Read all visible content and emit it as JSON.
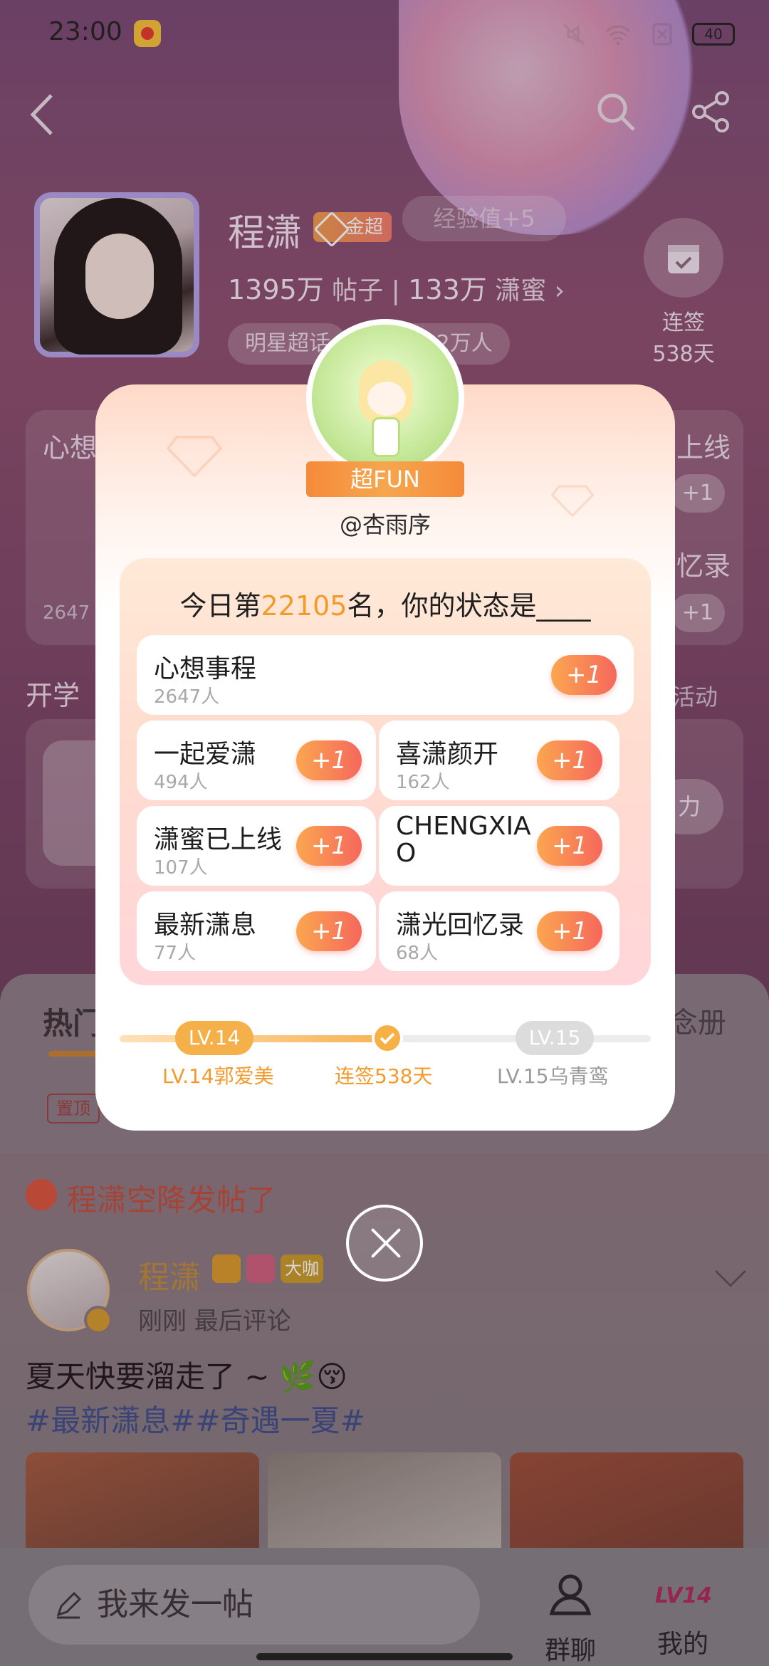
{
  "status_bar": {
    "time": "23:00",
    "battery": "40"
  },
  "header": {
    "name": "程潇",
    "badge": "金超",
    "ghost_pill": "经验值+5",
    "posts_count": "1395万",
    "posts_label": "帖子",
    "fans_count": "133万",
    "fans_label": "潇蜜",
    "tags": [
      "明星超话",
      "签到2.2万人"
    ],
    "checkin_label": "连签",
    "checkin_days": "538天"
  },
  "background": {
    "card_left_title": "心想",
    "card_left_count": "2647",
    "card_right_1": "上线",
    "card_right_2": "忆录",
    "plus": "+1",
    "section_left": "开学",
    "section_right": "活动",
    "tab_hot": "热门",
    "tab_right": "念册",
    "pin_label": "置顶",
    "post_title": "程潇空降发帖了",
    "post_name": "程潇",
    "post_level_badge": "大咖",
    "post_meta": "刚刚 最后评论",
    "post_text": "夏天快要溜走了 ~ 🌿😚",
    "post_tags": "#最新潇息##奇遇一夏#",
    "compose_placeholder": "我来发一帖",
    "nav_group": "群聊",
    "nav_mine": "我的",
    "nav_mine_level": "LV14",
    "side_button": "力"
  },
  "modal": {
    "fun_label": "超FUN",
    "handle": "@杏雨序",
    "rank_prefix": "今日第",
    "rank_number": "22105",
    "rank_suffix": "名，你的状态是____",
    "options": [
      {
        "title": "心想事程",
        "count": "2647人",
        "plus": "+1"
      },
      {
        "title": "一起爱潇",
        "count": "494人",
        "plus": "+1"
      },
      {
        "title": "喜潇颜开",
        "count": "162人",
        "plus": "+1"
      },
      {
        "title": "潇蜜已上线",
        "count": "107人",
        "plus": "+1"
      },
      {
        "title": "CHENGXIAO",
        "count": "",
        "plus": "+1"
      },
      {
        "title": "最新潇息",
        "count": "77人",
        "plus": "+1"
      },
      {
        "title": "潇光回忆录",
        "count": "68人",
        "plus": "+1"
      }
    ],
    "level_current": "LV.14",
    "level_next": "LV.15",
    "level_current_label": "LV.14郭爱美",
    "streak_label": "连签538天",
    "level_next_label": "LV.15乌青鸾",
    "progress_fraction": 0.5
  },
  "colors": {
    "accent": "#f39a2a",
    "plus_start": "#fba650",
    "plus_end": "#f6685c"
  }
}
